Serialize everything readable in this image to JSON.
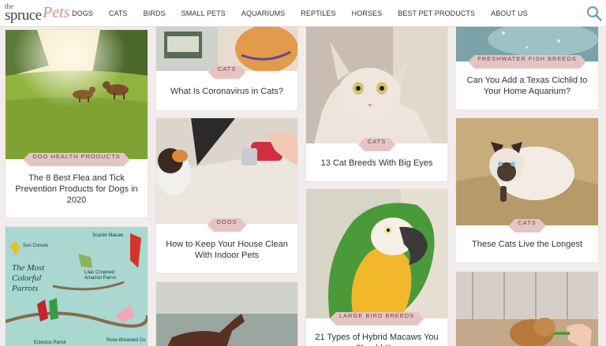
{
  "header": {
    "logo": {
      "the": "the",
      "spruce": "spruce",
      "pets": "Pets"
    },
    "nav": [
      "DOGS",
      "CATS",
      "BIRDS",
      "SMALL PETS",
      "AQUARIUMS",
      "REPTILES",
      "HORSES",
      "BEST PET PRODUCTS",
      "ABOUT US"
    ]
  },
  "cards": {
    "flea": {
      "tag": "DOG HEALTH PRODUCTS",
      "title": "The 8 Best Flea and Tick Prevention Products for Dogs in 2020"
    },
    "parrots_image": {
      "heading": "The Most Colorful Parrots",
      "labels": [
        "Sun Conure",
        "Scarlet Macaw",
        "Lilac Crowned Amazon Parrot",
        "Eclectus Parrot",
        "Rose-Breasted Co"
      ]
    },
    "coronavirus": {
      "tag": "CATS",
      "title": "What Is Coronavirus in Cats?"
    },
    "house_clean": {
      "tag": "DOGS",
      "title": "How to Keep Your House Clean With Indoor Pets"
    },
    "big_eyes": {
      "tag": "CATS",
      "title": "13 Cat Breeds With Big Eyes"
    },
    "macaws": {
      "tag": "LARGE BIRD BREEDS",
      "title": "21 Types of Hybrid Macaws You Should K..."
    },
    "cichlid": {
      "tag": "FRESHWATER FISH BREEDS",
      "title": "Can You Add a Texas Cichlid to Your Home Aquarium?"
    },
    "longest": {
      "tag": "CATS",
      "title": "These Cats Live the Longest"
    }
  }
}
